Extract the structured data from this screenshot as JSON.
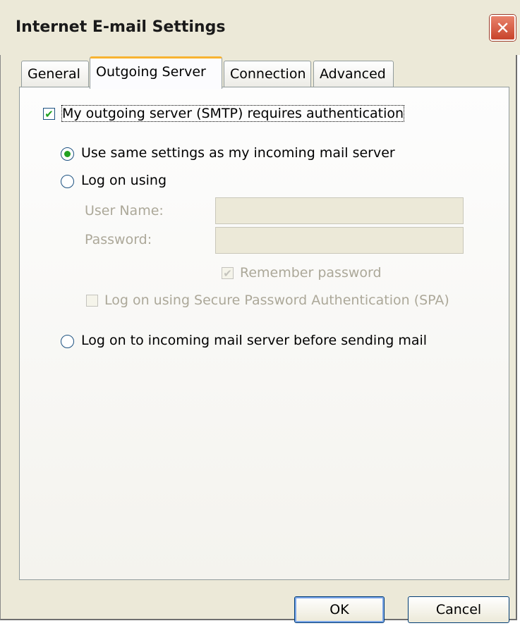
{
  "window": {
    "title": "Internet E-mail Settings",
    "close_glyph": "✕"
  },
  "tabs": [
    {
      "label": "General",
      "active": false
    },
    {
      "label": "Outgoing Server",
      "active": true
    },
    {
      "label": "Connection",
      "active": false
    },
    {
      "label": "Advanced",
      "active": false
    }
  ],
  "outgoing": {
    "requires_auth": {
      "label": "My outgoing server (SMTP) requires authentication",
      "checked": true
    },
    "same_settings": {
      "label": "Use same settings as my incoming mail server",
      "selected": true
    },
    "log_on_using": {
      "label": "Log on using",
      "selected": false
    },
    "user_name": {
      "label": "User Name:",
      "value": ""
    },
    "password": {
      "label": "Password:",
      "value": ""
    },
    "remember_password": {
      "label": "Remember password",
      "checked": true,
      "enabled": false
    },
    "spa": {
      "label": "Log on using Secure Password Authentication (SPA)",
      "checked": false,
      "enabled": false
    },
    "log_on_incoming": {
      "label": "Log on to incoming mail server before sending mail",
      "selected": false
    }
  },
  "buttons": {
    "ok": "OK",
    "cancel": "Cancel"
  }
}
